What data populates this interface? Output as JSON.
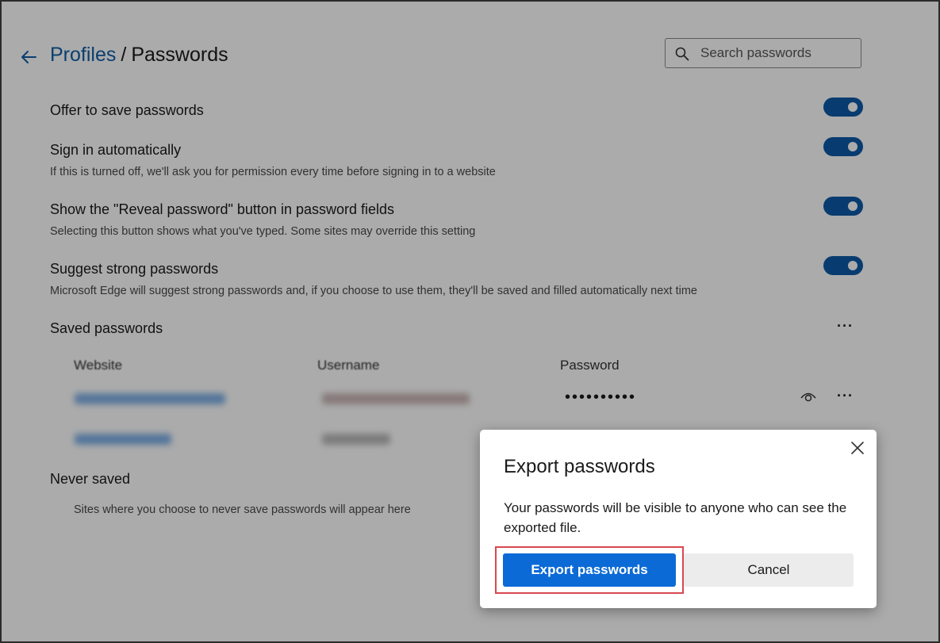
{
  "header": {
    "breadcrumb_parent": "Profiles",
    "breadcrumb_separator": "/",
    "breadcrumb_current": "Passwords",
    "search_placeholder": "Search passwords"
  },
  "settings": [
    {
      "title": "Offer to save passwords",
      "desc": "",
      "enabled": true
    },
    {
      "title": "Sign in automatically",
      "desc": "If this is turned off, we'll ask you for permission every time before signing in to a website",
      "enabled": true
    },
    {
      "title": "Show the \"Reveal password\" button in password fields",
      "desc": "Selecting this button shows what you've typed. Some sites may override this setting",
      "enabled": true
    },
    {
      "title": "Suggest strong passwords",
      "desc": "Microsoft Edge will suggest strong passwords and, if you choose to use them, they'll be saved and filled automatically next time",
      "enabled": true
    }
  ],
  "saved": {
    "title": "Saved passwords",
    "more_label": "···",
    "columns": {
      "website": "Website",
      "username": "Username",
      "password": "Password"
    },
    "rows": [
      {
        "password_mask": "••••••••••",
        "more_label": "···"
      }
    ]
  },
  "never_saved": {
    "title": "Never saved",
    "empty_text": "Sites where you choose to never save passwords will appear here"
  },
  "dialog": {
    "title": "Export passwords",
    "body": "Your passwords will be visible to anyone who can see the exported file.",
    "primary_label": "Export passwords",
    "secondary_label": "Cancel"
  },
  "colors": {
    "accent": "#0b6ad6",
    "link": "#0f5fa8",
    "toggle_on": "#0d5aa8",
    "highlight": "#d9474f"
  }
}
